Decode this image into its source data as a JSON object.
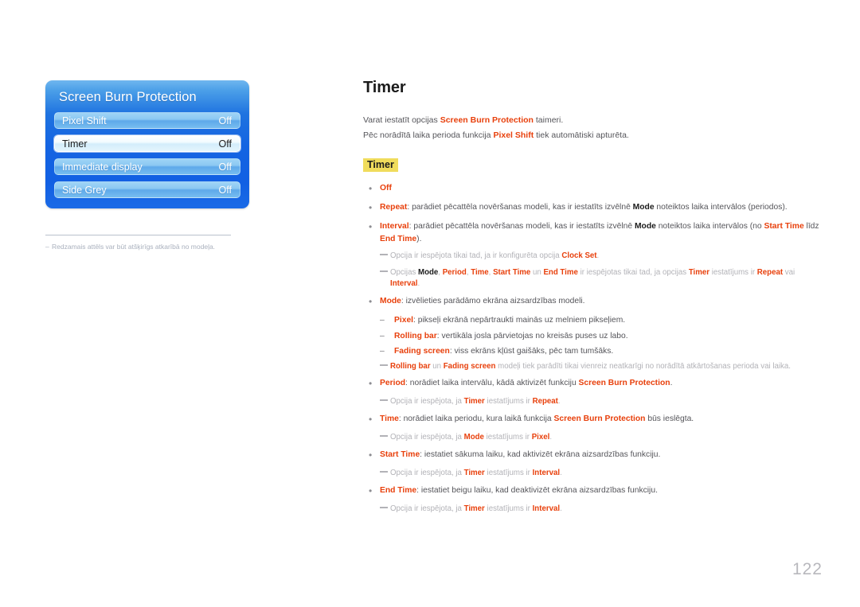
{
  "page": {
    "number": "122",
    "heading": "Timer"
  },
  "osd": {
    "title": "Screen Burn Protection",
    "rows": [
      {
        "label": "Pixel Shift",
        "value": "Off",
        "selected": false
      },
      {
        "label": "Timer",
        "value": "Off",
        "selected": true
      },
      {
        "label": "Immediate display",
        "value": "Off",
        "selected": false
      },
      {
        "label": "Side Grey",
        "value": "Off",
        "selected": false
      }
    ],
    "footnote": {
      "dash": "–",
      "text": "Redzamais attēls var būt atšķirīgs atkarībā no modeļa."
    }
  },
  "intro": {
    "line1_pre": "Varat iestatīt opcijas ",
    "line1_em": "Screen Burn Protection",
    "line1_post": " taimeri.",
    "line2_pre": "Pēc norādītā laika perioda funkcija ",
    "line2_em": "Pixel Shift",
    "line2_post": " tiek automātiski apturēta."
  },
  "highlight_heading": "Timer",
  "bullets": {
    "off": {
      "dot": "•",
      "label": "Off"
    },
    "repeat": {
      "dot": "•",
      "label": "Repeat",
      "t1": ": parādiet pēcattēla novēršanas modeli, kas ir iestatīts izvēlnē ",
      "em1": "Mode",
      "t2": " noteiktos laika intervālos (periodos)."
    },
    "interval": {
      "dot": "•",
      "label": "Interval",
      "t1": ": parādiet pēcattēla novēršanas modeli, kas ir iestatīts izvēlnē ",
      "em1": "Mode",
      "t2": " noteiktos laika intervālos (no ",
      "em2": "Start Time",
      "t3": " līdz ",
      "em3": "End Time",
      "t4": ")."
    },
    "note_clockset": {
      "t1": "Opcija ir iespējota tikai tad, ja ir konfigurēta opcija ",
      "em1": "Clock Set",
      "t2": "."
    },
    "note_modes": {
      "t1": "Opcijas ",
      "em1": "Mode",
      "t2": ", ",
      "em2": "Period",
      "t3": ", ",
      "em3": "Time",
      "t4": ", ",
      "em4": "Start Time",
      "t5": " un ",
      "em5": "End Time",
      "t6": " ir iespējotas tikai tad, ja opcijas ",
      "em6": "Timer",
      "t7": " iestatījums ir ",
      "em7": "Repeat",
      "t8": " vai ",
      "em8": "Interval",
      "t9": "."
    },
    "mode": {
      "dot": "•",
      "label": "Mode",
      "t1": ": izvēlieties parādāmo ekrāna aizsardzības modeli."
    },
    "mode_sub": [
      {
        "dash": "–",
        "label": "Pixel",
        "text": ": pikseļi ekrānā nepārtraukti mainās uz melniem pikseļiem."
      },
      {
        "dash": "–",
        "label": "Rolling bar",
        "text": ": vertikāla josla pārvietojas no kreisās puses uz labo."
      },
      {
        "dash": "–",
        "label": "Fading screen",
        "text": ": viss ekrāns kļūst gaišāks, pēc tam tumšāks."
      }
    ],
    "note_rolling": {
      "em1": "Rolling bar",
      "t1": " un ",
      "em2": "Fading screen",
      "t2": " modeļi tiek parādīti tikai vienreiz neatkarīgi no norādītā atkārtošanas perioda vai laika."
    },
    "period": {
      "dot": "•",
      "label": "Period",
      "t1": ": norādiet laika intervālu, kādā aktivizēt funkciju ",
      "em1": "Screen Burn Protection",
      "t2": "."
    },
    "note_period": {
      "t1": "Opcija ir iespējota, ja ",
      "em1": "Timer",
      "t2": " iestatījums ir ",
      "em2": "Repeat",
      "t3": "."
    },
    "time": {
      "dot": "•",
      "label": "Time",
      "t1": ": norādiet laika periodu, kura laikā funkcija ",
      "em1": "Screen Burn Protection",
      "t2": " būs ieslēgta."
    },
    "note_time": {
      "t1": "Opcija ir iespējota, ja ",
      "em1": "Mode",
      "t2": " iestatījums ir ",
      "em2": "Pixel",
      "t3": "."
    },
    "start_time": {
      "dot": "•",
      "label": "Start Time",
      "t1": ": iestatiet sākuma laiku, kad aktivizēt ekrāna aizsardzības funkciju."
    },
    "note_start": {
      "t1": "Opcija ir iespējota, ja ",
      "em1": "Timer",
      "t2": " iestatījums ir ",
      "em2": "Interval",
      "t3": "."
    },
    "end_time": {
      "dot": "•",
      "label": "End Time",
      "t1": ": iestatiet beigu laiku, kad deaktivizēt ekrāna aizsardzības funkciju."
    },
    "note_end": {
      "t1": "Opcija ir iespējota, ja ",
      "em1": "Timer",
      "t2": " iestatījums ir ",
      "em2": "Interval",
      "t3": "."
    }
  },
  "colors": {
    "accent_red": "#e8400c",
    "highlight_yellow": "#f0dc5c",
    "osd_blue": "#1464e2"
  }
}
